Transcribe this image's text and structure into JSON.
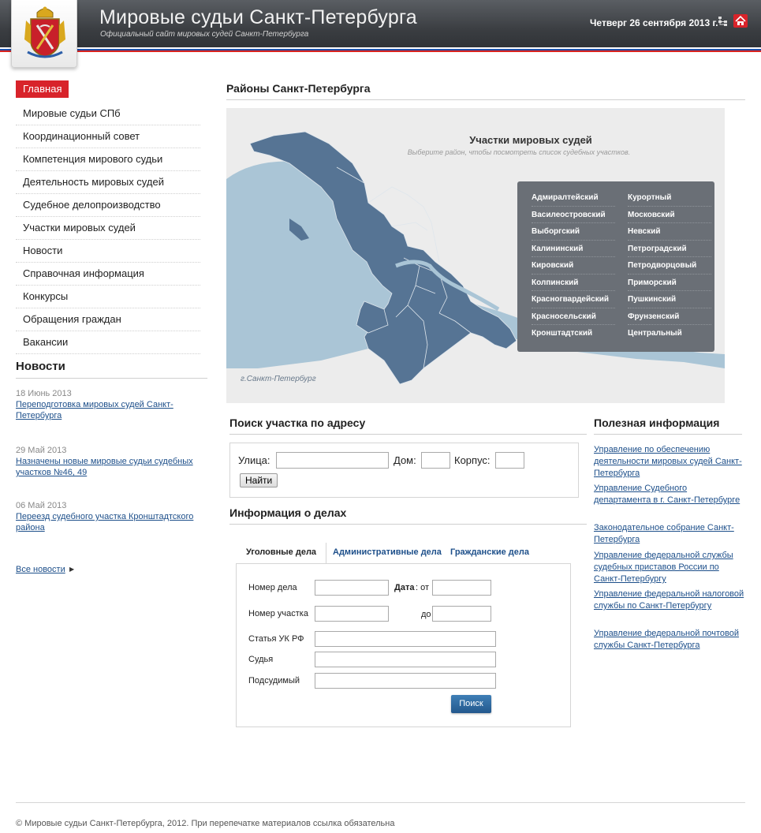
{
  "header": {
    "title": "Мировые судьи Санкт-Петербурга",
    "subtitle": "Официальный сайт мировых судей Санкт-Петербурга",
    "date": "Четверг 26 сентября 2013 г.",
    "accent_color": "#d8232a"
  },
  "nav": {
    "active": "Главная",
    "items": [
      "Мировые судьи СПб",
      "Координационный совет",
      "Компетенция мирового судьи",
      "Деятельность мировых судей",
      "Судебное делопроизводство",
      "Участки мировых судей",
      "Новости",
      "Справочная информация",
      "Конкурсы",
      "Обращения граждан",
      "Вакансии"
    ]
  },
  "news": {
    "title": "Новости",
    "items": [
      {
        "date": "18 Июнь 2013",
        "text": "Переподготовка мировых судей Санкт-Петербурга"
      },
      {
        "date": "29 Май 2013",
        "text": "Назначены новые мировые судьи судебных участков №46, 49"
      },
      {
        "date": "06 Май 2013",
        "text": "Переезд судебного участка Кронштадтского района"
      }
    ],
    "all_label": "Все новости"
  },
  "districts_section": {
    "title": "Районы Санкт-Петербурга",
    "map_title": "Участки мировых судей",
    "map_subtitle": "Выберите район, чтобы посмотреть список судебных участков.",
    "city_label": "г.Санкт-Петербург",
    "districts_left": [
      "Адмиралтейский",
      "Василеостровский",
      "Выборгский",
      "Калининский",
      "Кировский",
      "Колпинский",
      "Красногвардейский",
      "Красносельский",
      "Кронштадтский"
    ],
    "districts_right": [
      "Курортный",
      "Московский",
      "Невский",
      "Петроградский",
      "Петродворцовый",
      "Приморский",
      "Пушкинский",
      "Фрунзенский",
      "Центральный"
    ]
  },
  "address_search": {
    "title": "Поиск участка по адресу",
    "street_label": "Улица:",
    "house_label": "Дом:",
    "building_label": "Корпус:",
    "button": "Найти"
  },
  "cases": {
    "title": "Информация о делах",
    "tabs": [
      "Уголовные дела",
      "Административные дела",
      "Гражданские дела"
    ],
    "case_number_label": "Номер дела",
    "date_label": "Дата",
    "from_label": ": от",
    "to_label": "до",
    "district_number_label": "Номер участка",
    "article_label": "Статья УК РФ",
    "judge_label": "Судья",
    "defendant_label": "Подсудимый",
    "button": "Поиск"
  },
  "useful": {
    "title": "Полезная информация",
    "links": [
      "Управление по обеспечению деятельности мировых судей Санкт-Петербурга",
      "Управление Судебного департамента в г. Санкт-Петербурге",
      "Законодательное собрание Санкт-Петербурга",
      "Управление федеральной службы судебных приставов России по Санкт-Петербургу",
      "Управление федеральной налоговой службы по Санкт-Петербургу",
      "Управление федеральной почтовой службы Санкт-Петербурга"
    ]
  },
  "footer": {
    "text": "© Мировые судьи Санкт-Петербурга, 2012. При перепечатке материалов ссылка обязательна"
  }
}
